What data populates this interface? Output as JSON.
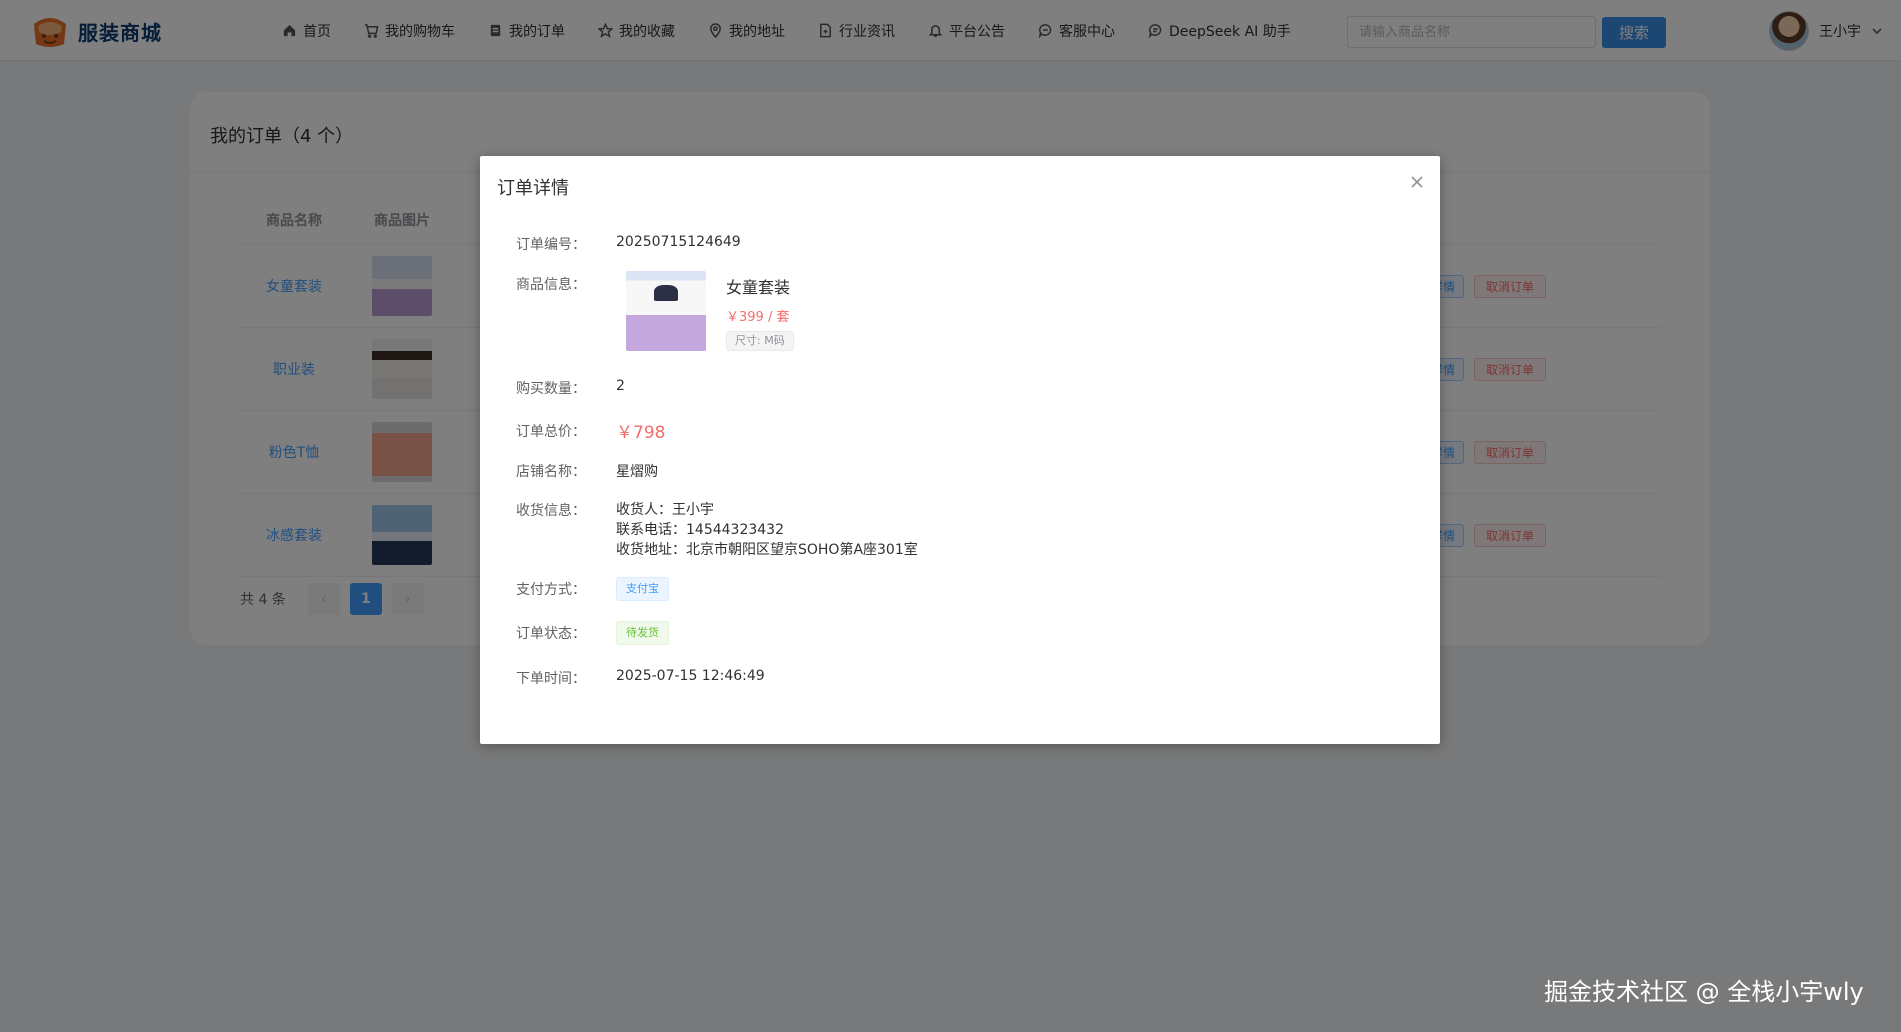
{
  "header": {
    "logo_text": "服装商城",
    "nav": [
      {
        "label": "首页",
        "icon": "home-icon"
      },
      {
        "label": "我的购物车",
        "icon": "cart-icon"
      },
      {
        "label": "我的订单",
        "icon": "order-icon"
      },
      {
        "label": "我的收藏",
        "icon": "star-icon"
      },
      {
        "label": "我的地址",
        "icon": "location-icon"
      },
      {
        "label": "行业资讯",
        "icon": "document-icon"
      },
      {
        "label": "平台公告",
        "icon": "bell-icon"
      },
      {
        "label": "客服中心",
        "icon": "chat-icon"
      },
      {
        "label": "DeepSeek AI 助手",
        "icon": "chat-bubble-icon"
      }
    ],
    "search_placeholder": "请输入商品名称",
    "search_button": "搜索",
    "user_name": "王小宇"
  },
  "orders": {
    "title": "我的订单（4 个）",
    "columns": {
      "name": "商品名称",
      "image": "商品图片"
    },
    "rows": [
      {
        "name": "女童套装",
        "detail": "详情",
        "cancel": "取消订单"
      },
      {
        "name": "职业装",
        "detail": "详情",
        "cancel": "取消订单"
      },
      {
        "name": "粉色T恤",
        "detail": "详情",
        "cancel": "取消订单"
      },
      {
        "name": "冰感套装",
        "detail": "详情",
        "cancel": "取消订单"
      }
    ],
    "pager": {
      "total": "共 4 条",
      "prev": "‹",
      "page": "1",
      "next": "›"
    }
  },
  "dialog": {
    "title": "订单详情",
    "labels": {
      "order_no": "订单编号：",
      "product": "商品信息：",
      "quantity": "购买数量：",
      "total": "订单总价：",
      "shop": "店铺名称：",
      "receiver": "收货信息：",
      "payment": "支付方式：",
      "status": "订单状态：",
      "time": "下单时间："
    },
    "order_no": "20250715124649",
    "product_name": "女童套装",
    "product_price": "￥399 / 套",
    "product_size": "尺寸: M码",
    "quantity": "2",
    "total": "￥798",
    "shop": "星熠购",
    "receiver_name": "收货人：王小宇",
    "receiver_phone": "联系电话：14544323432",
    "receiver_addr": "收货地址：北京市朝阳区望京SOHO第A座301室",
    "payment": "支付宝",
    "status": "待发货",
    "time": "2025-07-15 12:46:49"
  },
  "watermark": "掘金技术社区 @ 全栈小宇wly",
  "colors": {
    "primary": "#409eff",
    "danger": "#f56c6c",
    "success": "#67c23a",
    "brand": "#0d3b73"
  }
}
